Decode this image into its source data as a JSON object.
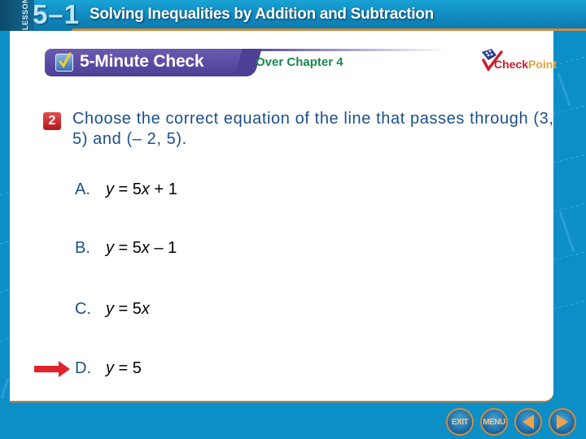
{
  "header": {
    "lesson_label": "LESSON",
    "lesson_number": "5–1",
    "lesson_title": "Solving Inequalities by Addition and Subtraction"
  },
  "banner": {
    "title": "5-Minute Check",
    "subtitle": "Over Chapter 4",
    "logo_part1": "Check",
    "logo_part2": "Point"
  },
  "question": {
    "number": "2",
    "text": "Choose the correct equation of the line that passes through (3, 5) and (– 2, 5)."
  },
  "options": [
    {
      "letter": "A.",
      "var": "y",
      "rest_pre": " = 5",
      "xvar": "x",
      "rest_post": " + 1",
      "correct": false
    },
    {
      "letter": "B.",
      "var": "y",
      "rest_pre": " = 5",
      "xvar": "x",
      "rest_post": " – 1",
      "correct": false
    },
    {
      "letter": "C.",
      "var": "y",
      "rest_pre": " = 5",
      "xvar": "x",
      "rest_post": "",
      "correct": false
    },
    {
      "letter": "D.",
      "var": "y",
      "rest_pre": " = 5",
      "xvar": "",
      "rest_post": "",
      "correct": true
    }
  ],
  "nav": {
    "exit": "EXIT",
    "menu": "MENU"
  },
  "colors": {
    "header_blue": "#0f86bd",
    "banner_purple": "#4d3f96",
    "subtitle_green": "#1c8750",
    "question_blue": "#1b4f8a",
    "arrow_red": "#e0222b",
    "accent_orange": "#d48a3e"
  }
}
